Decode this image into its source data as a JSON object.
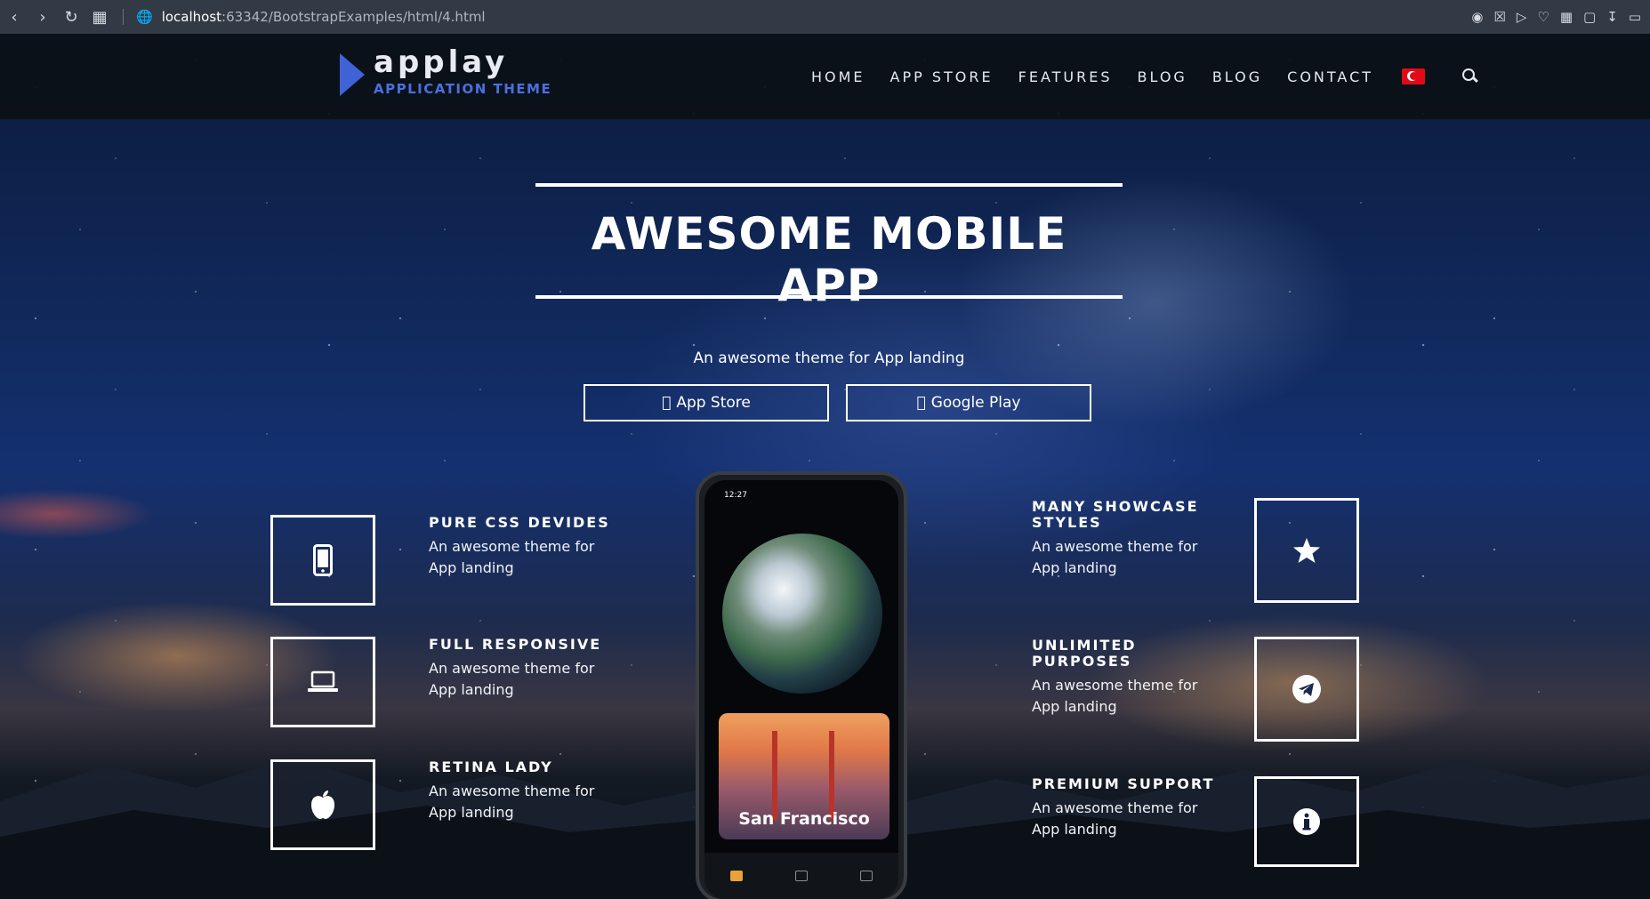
{
  "browser": {
    "url_host": "localhost",
    "url_path": ":63342/BootstrapExamples/html/4.html"
  },
  "brand": {
    "name": "applay",
    "tagline": "APPLICATION THEME",
    "accent_color": "#3f63d6"
  },
  "nav": {
    "items": [
      "HOME",
      "APP STORE",
      "FEATURES",
      "BLOG",
      "BLOG",
      "CONTACT"
    ],
    "flag": "turkey-flag-icon",
    "search": "search-icon"
  },
  "hero": {
    "title": "AWESOME MOBILE APP",
    "subtitle": "An awesome theme for App landing",
    "buttons": [
      {
        "label": "App Store",
        "icon": "apple-icon"
      },
      {
        "label": "Google Play",
        "icon": "apple-icon"
      }
    ]
  },
  "features_left": [
    {
      "title": "PURE CSS DEVIDES",
      "text": "An awesome theme for App landing",
      "icon": "mobile-icon"
    },
    {
      "title": "FULL RESPONSIVE",
      "text": "An awesome theme for App landing",
      "icon": "laptop-icon"
    },
    {
      "title": "RETINA LADY",
      "text": "An awesome theme for App landing",
      "icon": "apple-icon"
    }
  ],
  "features_right": [
    {
      "title": "MANY SHOWCASE STYLES",
      "text": "An awesome theme for App landing",
      "icon": "star-icon"
    },
    {
      "title": "UNLIMITED PURPOSES",
      "text": "An awesome theme for App landing",
      "icon": "telegram-icon"
    },
    {
      "title": "PREMIUM SUPPORT",
      "text": "An awesome theme for App landing",
      "icon": "info-icon"
    }
  ],
  "phone": {
    "time": "12:27",
    "card_title": "San Francisco"
  }
}
